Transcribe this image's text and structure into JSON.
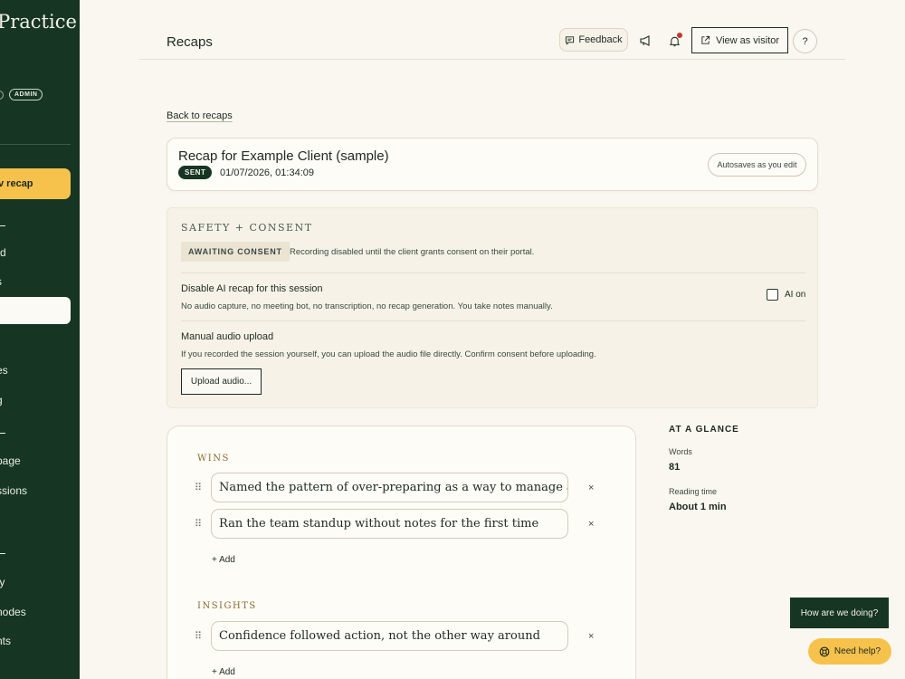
{
  "sidebar": {
    "brand": "e Practice",
    "role_badge": "ADMIN",
    "cta_label": "v recap",
    "items": [
      "rd",
      "s",
      "es",
      "g",
      "page",
      "ssions",
      "ty",
      "nodes",
      "nts"
    ]
  },
  "topbar": {
    "title": "Recaps",
    "feedback_label": "Feedback",
    "view_as_visitor_label": "View as visitor",
    "help_label": "?"
  },
  "back_link": "Back to recaps",
  "recap": {
    "title": "Recap for Example Client (sample)",
    "status": "SENT",
    "date": "01/07/2026, 01:34:09",
    "autosave": "Autosaves as you edit"
  },
  "safety": {
    "heading": "SAFETY + CONSENT",
    "consent_badge": "AWAITING CONSENT",
    "consent_text": "Recording disabled until the client grants consent on their portal.",
    "disable_title": "Disable AI recap for this session",
    "disable_desc": "No audio capture, no meeting bot, no transcription, no recap generation. You take notes manually.",
    "ai_toggle_label": "AI on",
    "upload_title": "Manual audio upload",
    "upload_desc": "If you recorded the session yourself, you can upload the audio file directly. Confirm consent before uploading.",
    "upload_button": "Upload audio..."
  },
  "content": {
    "wins_label": "WINS",
    "wins": [
      "Named the pattern of over-preparing as a way to manage anxiety",
      "Ran the team standup without notes for the first time"
    ],
    "insights_label": "INSIGHTS",
    "insights": [
      "Confidence followed action, not the other way around"
    ],
    "add_label": "+ Add",
    "remove_glyph": "×",
    "drag_glyph": "⠿"
  },
  "glance": {
    "heading": "AT A GLANCE",
    "words_label": "Words",
    "words_value": "81",
    "reading_label": "Reading time",
    "reading_value": "About 1 min"
  },
  "floating": {
    "how_are_we_doing": "How are we doing?",
    "need_help": "Need help?"
  }
}
